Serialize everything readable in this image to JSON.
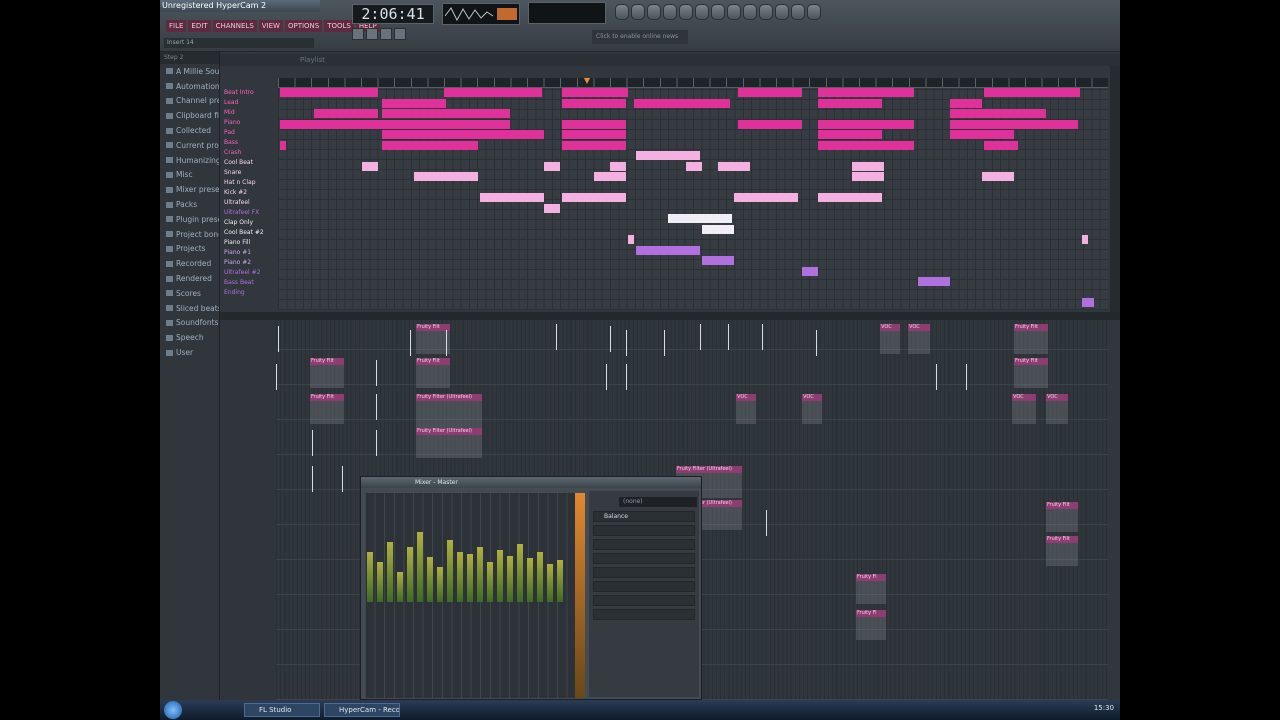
{
  "window": {
    "title": "Unregistered HyperCam 2"
  },
  "menu": [
    "FILE",
    "EDIT",
    "CHANNELS",
    "VIEW",
    "OPTIONS",
    "TOOLS",
    "HELP"
  ],
  "pattern_field": "Insert 14",
  "tempo_display": "2:06:41",
  "hint": "Click to enable online news",
  "browser": {
    "header": "Step 2",
    "items": [
      "A Millie Soun",
      "Automation",
      "Channel pres",
      "Clipboard file",
      "Collected",
      "Current proje",
      "Humanizing p",
      "Misc",
      "Mixer preset",
      "Packs",
      "Plugin preset",
      "Project bone",
      "Projects",
      "Recorded",
      "Rendered",
      "Scores",
      "Sliced beats",
      "Soundfonts",
      "Speech",
      "User"
    ]
  },
  "playlist": {
    "header": "Playlist",
    "patterns": [
      "Beat Intro",
      "Lead",
      "Mid",
      "Piano",
      "Pad",
      "Bass",
      "Crash",
      "Cool Beat",
      "Snare",
      "Hat n Clap",
      "Kick #2",
      "Ultrafeel",
      "Ultrafeel FX",
      "Clap Only",
      "Cool Beat #2",
      "Piano Fill",
      "Piano #1",
      "Piano #2",
      "Ultrafeel #2",
      "Bass Beat",
      "Ending"
    ]
  },
  "automation_labels": {
    "filter": "Fruity Filt",
    "filter_long": "Fruity Filter (Ultrafeel)",
    "vocal": "VOC",
    "short": "Fruity Fi"
  },
  "mixer": {
    "title": "Mixer - Master",
    "fx_input": "(none)",
    "slot1": "Balance"
  },
  "taskbar": {
    "task1": "FL Studio",
    "task2": "HyperCam - Record...",
    "clock": "15:30"
  },
  "colors": {
    "pattern_pink": "#e0309a",
    "pattern_light_pink": "#f4b0e0",
    "pattern_lavender": "#b070e0",
    "pattern_white": "#f0eef4",
    "automation_header": "#8e3c72"
  }
}
